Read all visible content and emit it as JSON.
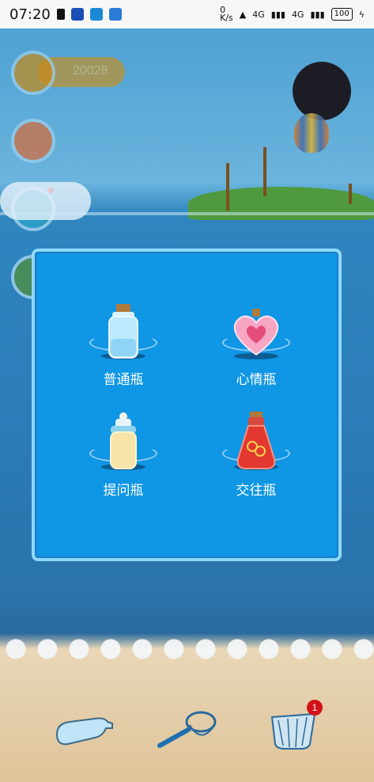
{
  "status_bar": {
    "time": "07:20",
    "network_speed": "0\nK/s",
    "signal_1": "4G",
    "signal_2": "4G",
    "battery": "100"
  },
  "coins": {
    "value": "20028"
  },
  "bottles_menu": {
    "items": [
      {
        "label": "普通瓶",
        "icon": "plain-bottle-icon"
      },
      {
        "label": "心情瓶",
        "icon": "heart-bottle-icon"
      },
      {
        "label": "提问瓶",
        "icon": "question-bottle-icon"
      },
      {
        "label": "交往瓶",
        "icon": "dating-bottle-icon"
      }
    ]
  },
  "bottom_bar": {
    "net_badge_count": "1"
  },
  "colors": {
    "modal_bg": "#0f96e4",
    "modal_border": "#8fd8ff",
    "badge": "#d21118"
  }
}
